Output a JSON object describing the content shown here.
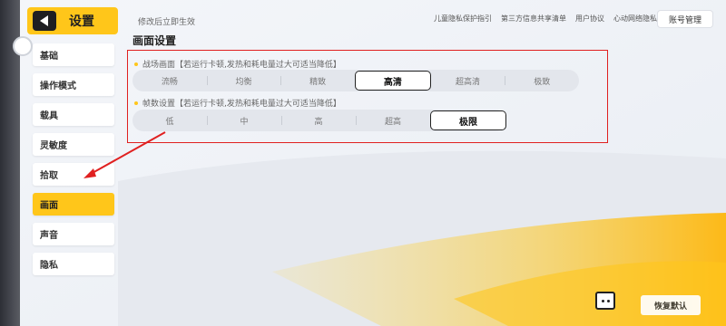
{
  "header": {
    "title": "设置",
    "hint": "修改后立即生效",
    "links": [
      "儿童隐私保护指引",
      "第三方信息共享清单",
      "用户协议",
      "心动网络隐私政策"
    ],
    "account_label": "账号管理"
  },
  "sidebar": {
    "items": [
      {
        "label": "基础",
        "active": false
      },
      {
        "label": "操作模式",
        "active": false
      },
      {
        "label": "载具",
        "active": false
      },
      {
        "label": "灵敏度",
        "active": false
      },
      {
        "label": "拾取",
        "active": false
      },
      {
        "label": "画面",
        "active": true
      },
      {
        "label": "声音",
        "active": false
      },
      {
        "label": "隐私",
        "active": false
      }
    ]
  },
  "main": {
    "section_title": "画面设置",
    "quality": {
      "label": "战场画面【若运行卡顿,发热和耗电量过大可适当降低】",
      "options": [
        "流畅",
        "均衡",
        "精致",
        "高清",
        "超高清",
        "极致"
      ],
      "selected": "高清"
    },
    "framerate": {
      "label": "帧数设置【若运行卡顿,发热和耗电量过大可适当降低】",
      "options": [
        "低",
        "中",
        "高",
        "超高",
        "极限"
      ],
      "selected": "极限"
    }
  },
  "footer": {
    "reset_label": "恢复默认"
  },
  "colors": {
    "accent": "#ffc61a",
    "annotation": "#e02020",
    "background": "#f2f4f8"
  }
}
